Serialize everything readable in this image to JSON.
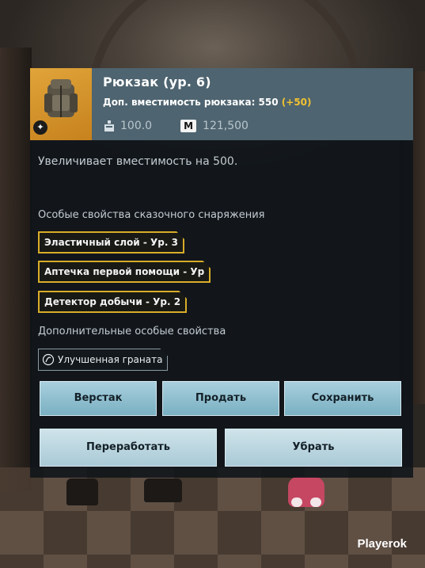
{
  "item": {
    "title": "Рюкзак (ур. 6)",
    "capacity_label": "Доп. вместимость рюкзака: 550",
    "capacity_bonus": "(+50)",
    "weight": "100.0",
    "price_badge": "M",
    "price": "121,500",
    "icon": "backpack-icon",
    "description": "Увеличивает вместимость на 500."
  },
  "special_props": {
    "title": "Особые свойства сказочного снаряжения",
    "items": [
      "Эластичный слой - Ур. 3",
      "Аптечка первой помощи - Ур",
      "Детектор добычи - Ур. 2"
    ]
  },
  "extra_props": {
    "title": "Дополнительные особые свойства",
    "items": [
      "Улучшенная граната"
    ]
  },
  "buttons": {
    "workbench": "Верстак",
    "sell": "Продать",
    "save": "Сохранить",
    "recycle": "Переработать",
    "remove": "Убрать"
  },
  "watermark": "Playerok",
  "colors": {
    "accent_gold": "#d8ad28",
    "bonus_yellow": "#f2c230",
    "header_bg": "#4e6470",
    "button_blue": "#79b0c2"
  }
}
